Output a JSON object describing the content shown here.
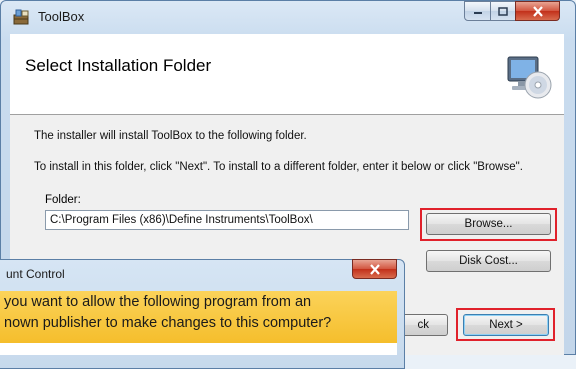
{
  "installer": {
    "title": "ToolBox",
    "page_title": "Select Installation Folder",
    "info_line_1": "The installer will install ToolBox to the following folder.",
    "info_line_2": "To install in this folder, click \"Next\". To install to a different folder, enter it below or click \"Browse\".",
    "folder_label": "Folder:",
    "folder_value": "C:\\Program Files (x86)\\Define Instruments\\ToolBox\\",
    "browse_label": "Browse...",
    "disk_cost_label": "Disk Cost...",
    "back_label": "ck",
    "next_label": "Next >"
  },
  "uac": {
    "title": "unt Control",
    "question_line_1": "you want to allow the following program from an",
    "question_line_2": "nown publisher to make changes to this computer?"
  },
  "colors": {
    "highlight": "#e0212b",
    "uac_banner": "#f5be2c"
  },
  "icons": [
    "app-icon",
    "minimize-icon",
    "maximize-icon",
    "close-icon",
    "computer-disc-icon"
  ]
}
